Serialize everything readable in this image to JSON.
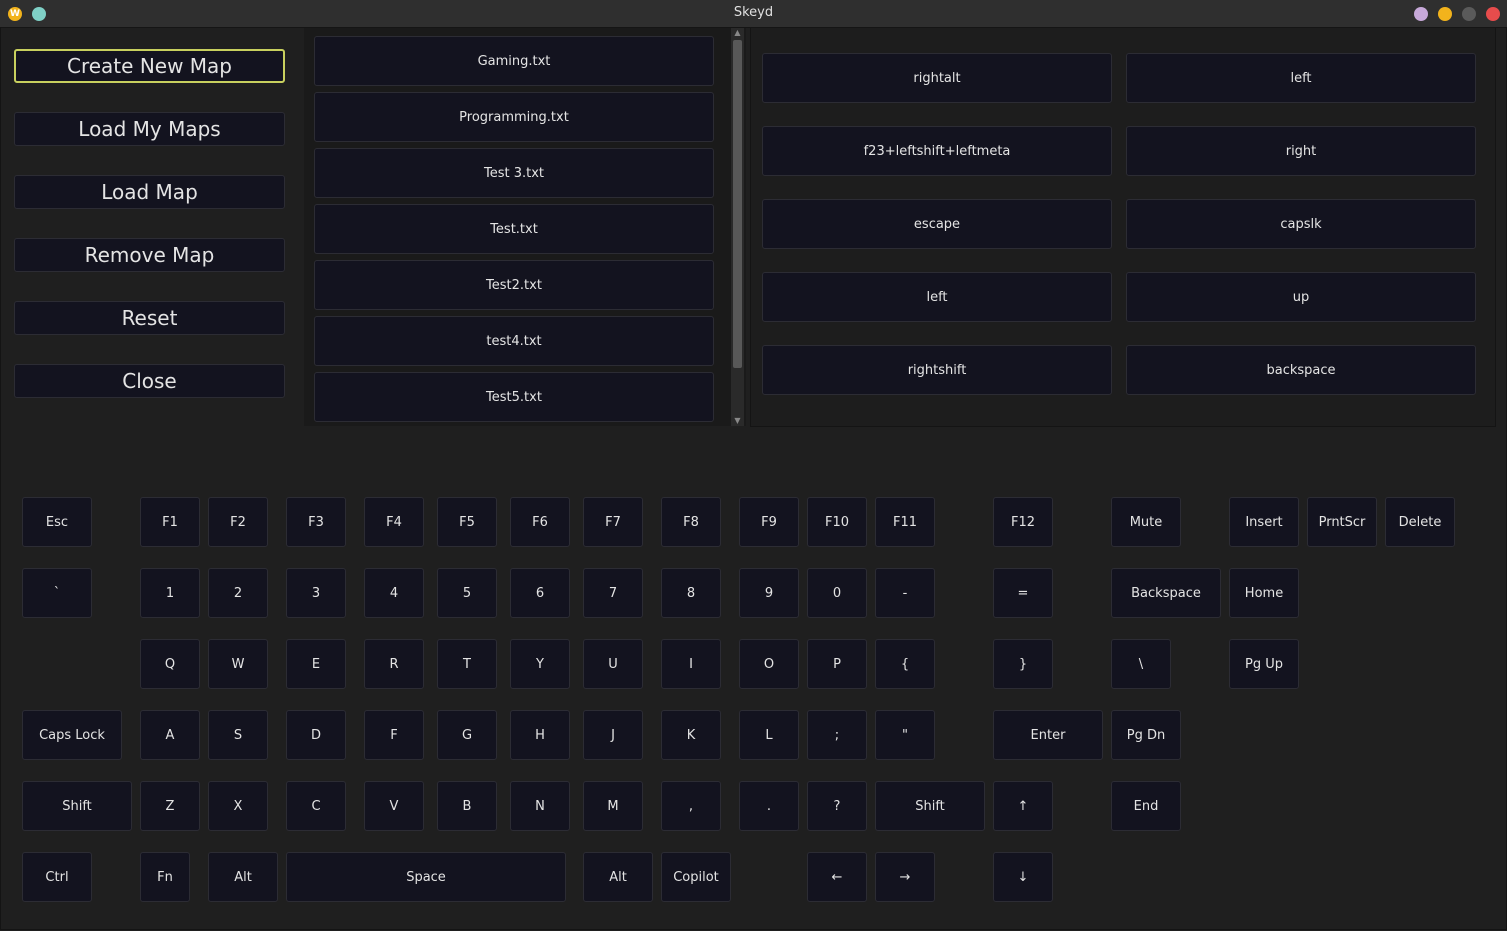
{
  "window": {
    "title": "Skeyd",
    "app_icon_glyph": "W"
  },
  "menu": {
    "create_new_map": "Create New Map",
    "load_my_maps": "Load My Maps",
    "load_map": "Load Map",
    "remove_map": "Remove Map",
    "reset": "Reset",
    "close": "Close"
  },
  "files": [
    "Gaming.txt",
    "Programming.txt",
    "Test 3.txt",
    "Test.txt",
    "Test2.txt",
    "test4.txt",
    "Test5.txt"
  ],
  "mappings": [
    {
      "from": "rightalt",
      "to": "left"
    },
    {
      "from": "f23+leftshift+leftmeta",
      "to": "right"
    },
    {
      "from": "escape",
      "to": "capslk"
    },
    {
      "from": "left",
      "to": "up"
    },
    {
      "from": "rightshift",
      "to": "backspace"
    }
  ],
  "keyboard": {
    "row_fn": [
      "Esc",
      "F1",
      "F2",
      "F3",
      "F4",
      "F5",
      "F6",
      "F7",
      "F8",
      "F9",
      "F10",
      "F11",
      "F12",
      "Mute",
      "Insert",
      "PrntScr",
      "Delete"
    ],
    "row_num": [
      "`",
      "1",
      "2",
      "3",
      "4",
      "5",
      "6",
      "7",
      "8",
      "9",
      "0",
      "-",
      "=",
      "Backspace",
      "Home"
    ],
    "row_q": [
      "Q",
      "W",
      "E",
      "R",
      "T",
      "Y",
      "U",
      "I",
      "O",
      "P",
      "{",
      "}",
      "\\",
      "Pg Up"
    ],
    "row_a": [
      "Caps Lock",
      "A",
      "S",
      "D",
      "F",
      "G",
      "H",
      "J",
      "K",
      "L",
      ";",
      "\"",
      "Enter",
      "Pg Dn"
    ],
    "row_z": [
      "Shift",
      "Z",
      "X",
      "C",
      "V",
      "B",
      "N",
      "M",
      ",",
      ".",
      "?",
      "Shift",
      "↑",
      "End"
    ],
    "row_ctrl": [
      "Ctrl",
      "Fn",
      "Alt",
      "Space",
      "Alt",
      "Copilot",
      "←",
      "→",
      "↓"
    ]
  },
  "scrollbar": {
    "up_arrow": "▲",
    "down_arrow": "▼"
  }
}
